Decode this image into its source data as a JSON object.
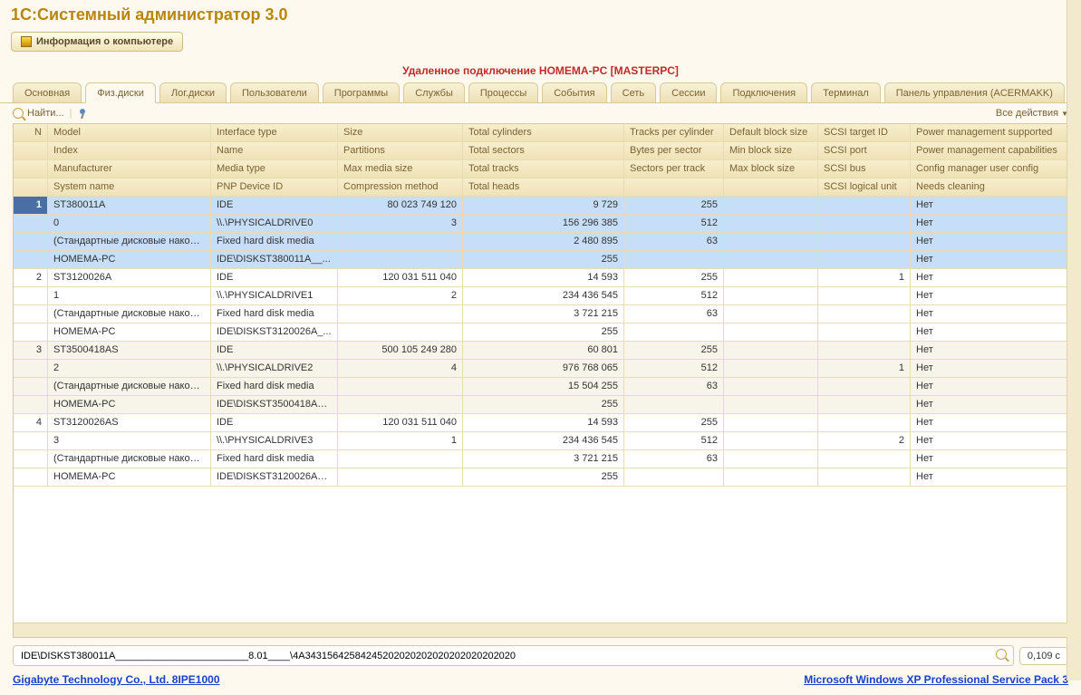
{
  "title": "1С:Системный администратор 3.0",
  "info_button": "Информация о компьютере",
  "remote_line": "Удаленное подключение HOMEMA-PC [MASTERPC]",
  "tabs": [
    "Основная",
    "Физ.диски",
    "Лог.диски",
    "Пользователи",
    "Программы",
    "Службы",
    "Процессы",
    "События",
    "Сеть",
    "Сессии",
    "Подключения",
    "Терминал",
    "Панель управления (ACERMAKK)"
  ],
  "active_tab": 1,
  "toolbar": {
    "find": "Найти...",
    "all_actions": "Все действия"
  },
  "columns": {
    "row1": [
      "N",
      "Model",
      "Interface type",
      "Size",
      "Total cylinders",
      "Tracks per cylinder",
      "Default block size",
      "SCSI target ID",
      "Power management supported"
    ],
    "row2": [
      "",
      "Index",
      "Name",
      "Partitions",
      "Total sectors",
      "Bytes per sector",
      "Min block size",
      "SCSI port",
      "Power management capabilities"
    ],
    "row3": [
      "",
      "Manufacturer",
      "Media type",
      "Max media size",
      "Total tracks",
      "Sectors per track",
      "Max block size",
      "SCSI bus",
      "Config manager user config"
    ],
    "row4": [
      "",
      "System name",
      "PNP Device ID",
      "Compression method",
      "Total heads",
      "",
      "",
      "SCSI logical unit",
      "Needs cleaning"
    ]
  },
  "rows": [
    {
      "n": "1",
      "selected": true,
      "r1": [
        "ST380011A",
        "IDE",
        "80 023 749 120",
        "9 729",
        "255",
        "",
        "",
        "Нет"
      ],
      "r2": [
        "0",
        "\\\\.\\PHYSICALDRIVE0",
        "3",
        "156 296 385",
        "512",
        "",
        "",
        "Нет"
      ],
      "r3": [
        "(Стандартные дисковые накопи...",
        "Fixed   hard disk media",
        "",
        "2 480 895",
        "63",
        "",
        "",
        "Нет"
      ],
      "r4": [
        "HOMEMA-PC",
        "IDE\\DISKST380011A__...",
        "",
        "255",
        "",
        "",
        "",
        "Нет"
      ]
    },
    {
      "n": "2",
      "r1": [
        "ST3120026A",
        "IDE",
        "120 031 511 040",
        "14 593",
        "255",
        "",
        "1",
        "Нет"
      ],
      "r2": [
        "1",
        "\\\\.\\PHYSICALDRIVE1",
        "2",
        "234 436 545",
        "512",
        "",
        "",
        "Нет"
      ],
      "r3": [
        "(Стандартные дисковые накопи...",
        "Fixed   hard disk media",
        "",
        "3 721 215",
        "63",
        "",
        "",
        "Нет"
      ],
      "r4": [
        "HOMEMA-PC",
        "IDE\\DISKST3120026A_...",
        "",
        "255",
        "",
        "",
        "",
        "Нет"
      ]
    },
    {
      "n": "3",
      "r1": [
        "ST3500418AS",
        "IDE",
        "500 105 249 280",
        "60 801",
        "255",
        "",
        "",
        "Нет"
      ],
      "r2": [
        "2",
        "\\\\.\\PHYSICALDRIVE2",
        "4",
        "976 768 065",
        "512",
        "",
        "1",
        "Нет"
      ],
      "r3": [
        "(Стандартные дисковые накопи...",
        "Fixed   hard disk media",
        "",
        "15 504 255",
        "63",
        "",
        "",
        "Нет"
      ],
      "r4": [
        "HOMEMA-PC",
        "IDE\\DISKST3500418AS...",
        "",
        "255",
        "",
        "",
        "",
        "Нет"
      ]
    },
    {
      "n": "4",
      "r1": [
        "ST3120026AS",
        "IDE",
        "120 031 511 040",
        "14 593",
        "255",
        "",
        "",
        "Нет"
      ],
      "r2": [
        "3",
        "\\\\.\\PHYSICALDRIVE3",
        "1",
        "234 436 545",
        "512",
        "",
        "2",
        "Нет"
      ],
      "r3": [
        "(Стандартные дисковые накопи...",
        "Fixed   hard disk media",
        "",
        "3 721 215",
        "63",
        "",
        "",
        "Нет"
      ],
      "r4": [
        "HOMEMA-PC",
        "IDE\\DISKST3120026AS...",
        "",
        "255",
        "",
        "",
        "",
        "Нет"
      ]
    }
  ],
  "bottom_input": "IDE\\DISKST380011A________________________8.01____\\4A34315642584245202020202020202020202020",
  "time": "0,109 с",
  "footer": {
    "left": "Gigabyte Technology Co., Ltd. 8IPE1000",
    "right": "Microsoft Windows XP Professional Service Pack 3"
  }
}
